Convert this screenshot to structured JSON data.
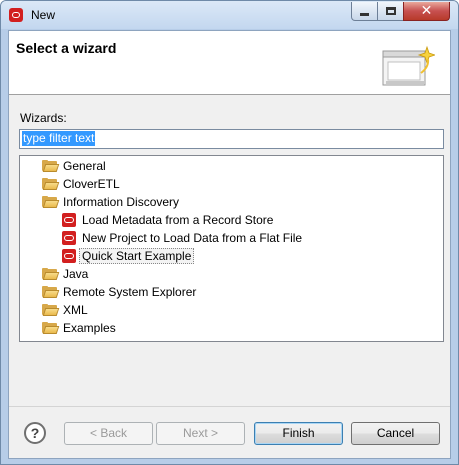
{
  "window": {
    "title": "New"
  },
  "header": {
    "title": "Select a wizard"
  },
  "wizards_label": "Wizards:",
  "filter": {
    "value": "type filter text"
  },
  "tree": {
    "items": [
      {
        "label": "General",
        "type": "folder",
        "depth": 0
      },
      {
        "label": "CloverETL",
        "type": "folder",
        "depth": 0
      },
      {
        "label": "Information Discovery",
        "type": "folder",
        "depth": 0
      },
      {
        "label": "Load Metadata from a Record Store",
        "type": "oracle",
        "depth": 1
      },
      {
        "label": "New Project to Load Data from a Flat File",
        "type": "oracle",
        "depth": 1
      },
      {
        "label": "Quick Start Example",
        "type": "oracle",
        "depth": 1,
        "selected": true
      },
      {
        "label": "Java",
        "type": "folder",
        "depth": 0
      },
      {
        "label": "Remote System Explorer",
        "type": "folder",
        "depth": 0
      },
      {
        "label": "XML",
        "type": "folder",
        "depth": 0
      },
      {
        "label": "Examples",
        "type": "folder",
        "depth": 0
      }
    ]
  },
  "buttons": {
    "help": "?",
    "back": "< Back",
    "next": "Next >",
    "finish": "Finish",
    "cancel": "Cancel"
  },
  "colors": {
    "accent": "#d21f1f",
    "selection": "#3399ff"
  }
}
